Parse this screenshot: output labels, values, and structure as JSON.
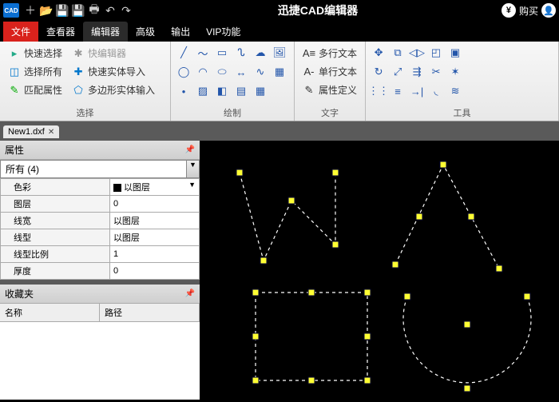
{
  "app": {
    "title": "迅捷CAD编辑器",
    "logo": "CAD",
    "buy": "购买"
  },
  "menutabs": [
    "文件",
    "查看器",
    "编辑器",
    "高级",
    "输出",
    "VIP功能"
  ],
  "ribbon": {
    "select": {
      "label": "选择",
      "quick": "快速选择",
      "quickedit": "快编辑器",
      "all": "选择所有",
      "entimp": "快速实体导入",
      "match": "匹配属性",
      "poly": "多边形实体输入"
    },
    "draw": {
      "label": "绘制"
    },
    "text": {
      "label": "文字",
      "multi": "多行文本",
      "single": "单行文本",
      "attr": "属性定义"
    },
    "tools": {
      "label": "工具"
    }
  },
  "doc": {
    "name": "New1.dxf"
  },
  "prop": {
    "title": "属性",
    "filter": "所有 (4)",
    "rows": {
      "color_k": "色彩",
      "color_v": "以图层",
      "layer_k": "图层",
      "layer_v": "0",
      "lw_k": "线宽",
      "lw_v": "以图层",
      "lt_k": "线型",
      "lt_v": "以图层",
      "ls_k": "线型比例",
      "ls_v": "1",
      "th_k": "厚度",
      "th_v": "0"
    }
  },
  "fav": {
    "title": "收藏夹",
    "col1": "名称",
    "col2": "路径"
  }
}
